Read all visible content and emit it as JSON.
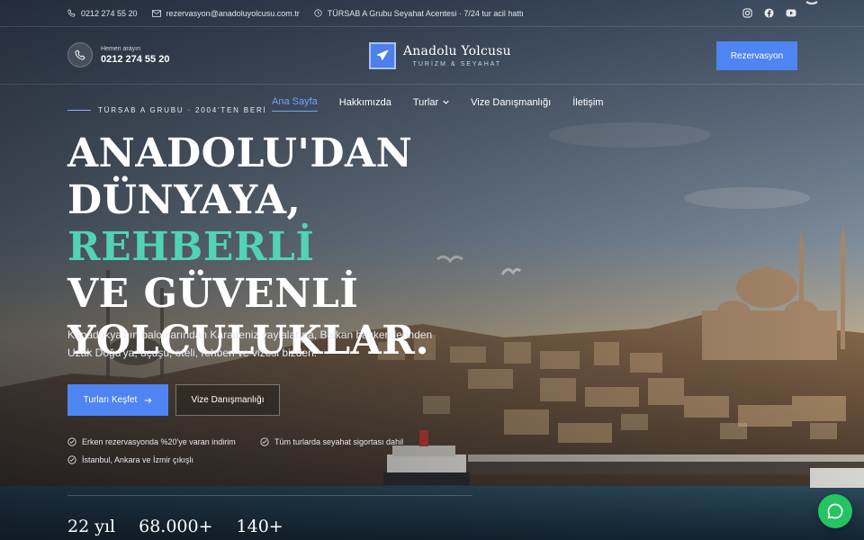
{
  "topbar": {
    "phone": "0212 274 55 20",
    "email": "rezervasyon@anadoluyolcusu.com.tr",
    "hours": "TÜRSAB A Grubu Seyahat Acentesi · 7/24 tur acil hattı",
    "social": [
      "instagram-icon",
      "facebook-icon",
      "youtube-icon"
    ]
  },
  "header": {
    "call_label": "Hemen arayın",
    "call_number": "0212 274 55 20",
    "logo_name": "Anadolu Yolcusu",
    "logo_sub": "TURİZM & SEYAHAT",
    "reserve_label": "Rezervasyon"
  },
  "nav": {
    "tagline": "TÜRSAB A GRUBU · 2004'TEN BERİ",
    "items": [
      {
        "label": "Ana Sayfa",
        "active": true
      },
      {
        "label": "Hakkımızda"
      },
      {
        "label": "Turlar",
        "dropdown": true
      },
      {
        "label": "Vize Danışmanlığı"
      },
      {
        "label": "İletişim"
      }
    ]
  },
  "hero": {
    "line1": "ANADOLU'DAN",
    "line2a": "DÜNYAYA, ",
    "line2b": "REHBERLİ",
    "line3": "VE GÜVENLİ",
    "line4": "YOLCULUKLAR.",
    "description": "Kapadokya'nın balonlarından Karadeniz yaylalarına, Balkan başkentlerinden Uzak Doğu'ya; uçuşu, oteli, rehberi ve vizesi bizden.",
    "primary_cta": "Turları Keşfet",
    "secondary_cta": "Vize Danışmanlığı",
    "features": [
      "Erken rezervasyonda %20'ye varan indirim",
      "Tüm turlarda seyahat sigortası dahil",
      "İstanbul, Ankara ve İzmir çıkışlı"
    ],
    "stats": [
      "22 yıl",
      "68.000+",
      "140+"
    ]
  },
  "colors": {
    "accent": "#4f85f2",
    "highlight": "#52d2b6",
    "whatsapp": "#25c463"
  }
}
